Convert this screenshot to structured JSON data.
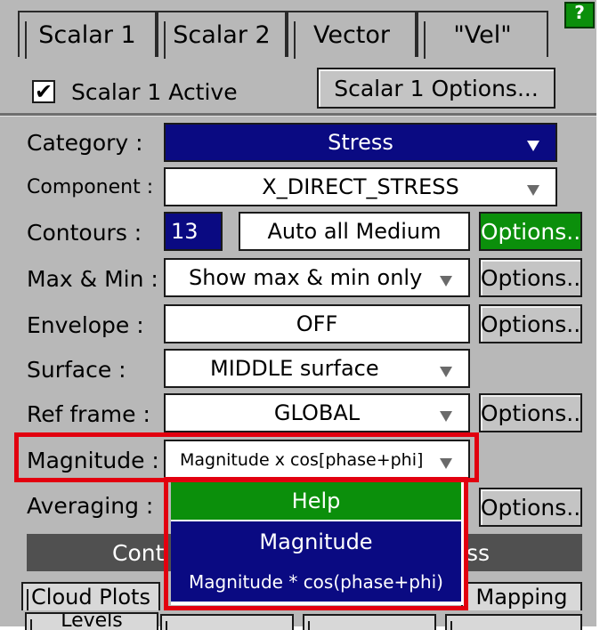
{
  "tabs": [
    "Scalar 1",
    "Scalar 2",
    "Vector",
    "\"Vel\""
  ],
  "help_badge": "?",
  "active": {
    "checked": true,
    "label": "Scalar 1 Active",
    "options_button": "Scalar 1 Options..."
  },
  "rows": {
    "category": {
      "label": "Category :",
      "value": "Stress"
    },
    "component": {
      "label": "Component :",
      "value": "X_DIRECT_STRESS"
    },
    "contours": {
      "label": "Contours :",
      "count": "13",
      "mode": "Auto all Medium",
      "options": "Options.."
    },
    "maxmin": {
      "label": "Max & Min :",
      "value": "Show max & min only",
      "options": "Options.."
    },
    "envelope": {
      "label": "Envelope :",
      "value": "OFF",
      "options": "Options.."
    },
    "surface": {
      "label": "Surface :",
      "value": "MIDDLE surface"
    },
    "ref_frame": {
      "label": "Ref frame :",
      "value": "GLOBAL",
      "options": "Options.."
    },
    "magnitude": {
      "label": "Magnitude :",
      "value": "Magnitude x cos[phase+phi]"
    },
    "averaging": {
      "label": "Averaging :",
      "options": "Options.."
    }
  },
  "dark_bar": {
    "left_text": "Cont",
    "right_text": "ss"
  },
  "dropdown": {
    "items": [
      "Help",
      "Magnitude",
      "Magnitude * cos(phase+phi)"
    ]
  },
  "bottom_tabs": {
    "row1": [
      "Cloud Plots",
      "Mapping"
    ],
    "row2": [
      "Levels"
    ]
  },
  "colors": {
    "panel": "#b8b8b8",
    "selected_blue": "#0a0a82",
    "green": "#0b8f0b",
    "highlight_red": "#e2000f"
  }
}
